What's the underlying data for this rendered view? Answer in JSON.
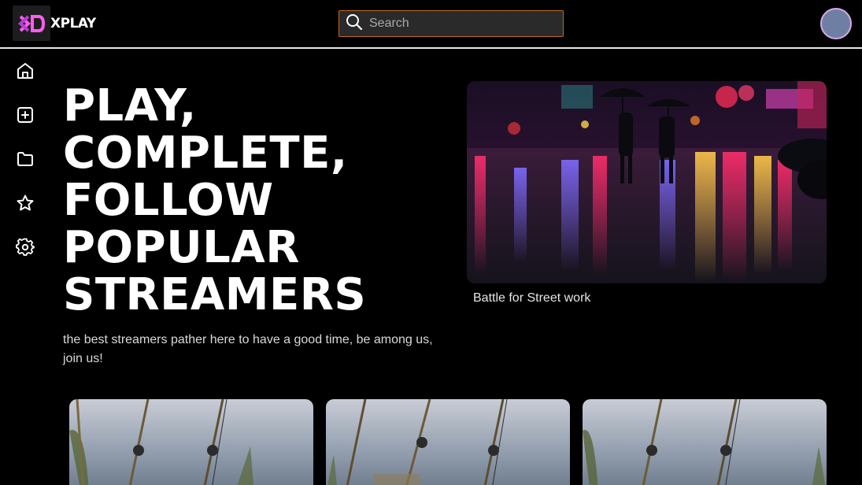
{
  "header": {
    "brand": "XPLAY",
    "search_placeholder": "Search",
    "brand_color": "#ff5cf0"
  },
  "sidebar": {
    "items": [
      {
        "name": "home",
        "icon": "home-icon"
      },
      {
        "name": "add",
        "icon": "plus-square-icon"
      },
      {
        "name": "folder",
        "icon": "folder-icon"
      },
      {
        "name": "favorites",
        "icon": "star-icon"
      },
      {
        "name": "settings",
        "icon": "gear-icon"
      }
    ]
  },
  "hero": {
    "title_lines": [
      "PLAY,",
      "COMPLETE,",
      "FOLLOW",
      "POPULAR",
      "STREAMERS"
    ],
    "subtitle": "the best streamers pather here to have a good time, be among us, join us!"
  },
  "featured": {
    "caption": "Battle for Street work",
    "image": "rainy neon street with people holding umbrellas"
  },
  "cards": [
    {
      "image": "fishing rods by the lake"
    },
    {
      "image": "fishing rods by the lake"
    },
    {
      "image": "fishing rods by the lake"
    }
  ]
}
